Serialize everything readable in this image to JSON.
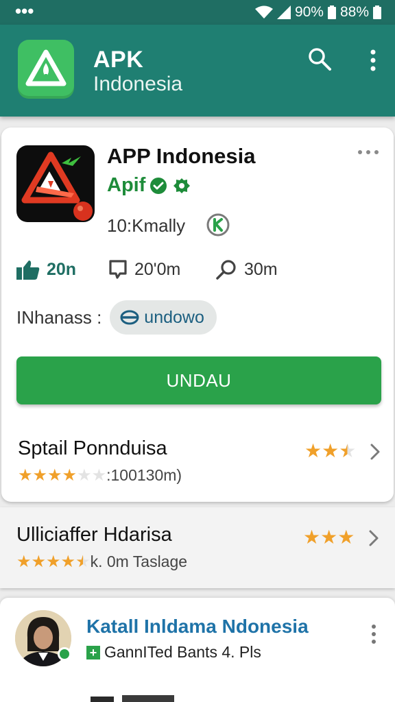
{
  "status_bar": {
    "left_dots": "•••",
    "battery1": "90%",
    "battery2": "88%"
  },
  "app_bar": {
    "title": "APK",
    "subtitle": "Indonesia",
    "logo_icon": "apk-triangle-logo",
    "search_icon": "search-icon",
    "menu_icon": "more-vertical-icon"
  },
  "app_card": {
    "title": "APP Indonesia",
    "developer": "Apif",
    "verified_icon": "verified-check-icon",
    "settings_icon": "gear-icon",
    "meta_text": "10:Kmally",
    "meta_badge_icon": "k-circle-icon",
    "stats": {
      "likes": "20n",
      "comments": "20'0m",
      "searches": "30m"
    },
    "tags_label": "INhanass :",
    "chip_label": "undowo",
    "install_label": "UNDAU",
    "rows": [
      {
        "title": "Sptail Ponnduisa",
        "sub_text": ":100130m)",
        "stars_small": 4,
        "rating_big": 2.5
      }
    ]
  },
  "second_card": {
    "title": "Ulliciaffer Hdarisa",
    "sub_text": "k. 0m Taslage",
    "stars_small": 4.5,
    "rating_big": 3
  },
  "third_card": {
    "title": "Katall Inldama Ndonesia",
    "sub_text": "GannITed Bants 4. Pls",
    "plus_label": "+"
  },
  "colors": {
    "status_bar": "#1f6e63",
    "app_bar": "#1f7f72",
    "accent_green": "#2aa24a",
    "star": "#f0a02a",
    "link_blue": "#1f73a8"
  }
}
